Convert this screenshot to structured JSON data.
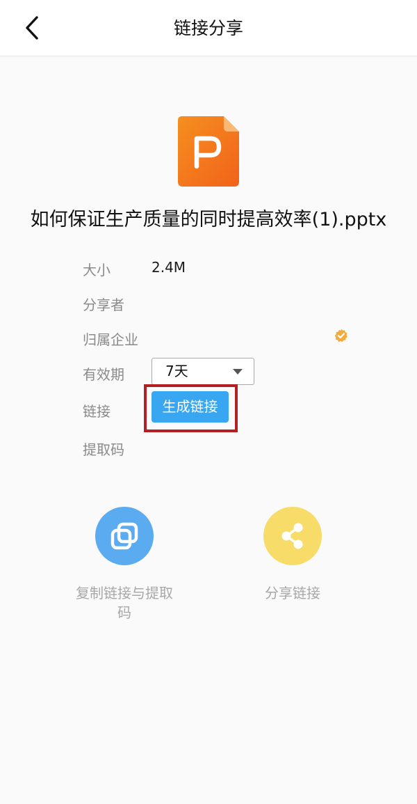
{
  "header": {
    "title": "链接分享",
    "back_icon": "chevron-left-icon"
  },
  "file": {
    "icon": "pptx-file-icon",
    "icon_letter": "P",
    "name": "如何保证生产质量的同时提高效率(1).pptx"
  },
  "info": {
    "size_label": "大小",
    "size_value": "2.4M",
    "sharer_label": "分享者",
    "sharer_value": "",
    "company_label": "归属企业",
    "company_value": "",
    "validity_label": "有效期",
    "validity_value": "7天",
    "link_label": "链接",
    "generate_button": "生成链接",
    "code_label": "提取码",
    "code_value": ""
  },
  "actions": {
    "copy_label": "复制链接与提取码",
    "share_label": "分享链接"
  },
  "colors": {
    "primary_blue": "#38a6f0",
    "copy_circle": "#5aabef",
    "share_circle": "#f7dc6a",
    "highlight": "#b41f24",
    "badge": "#f0ac3e",
    "ppt_orange": "#f47b1a"
  }
}
